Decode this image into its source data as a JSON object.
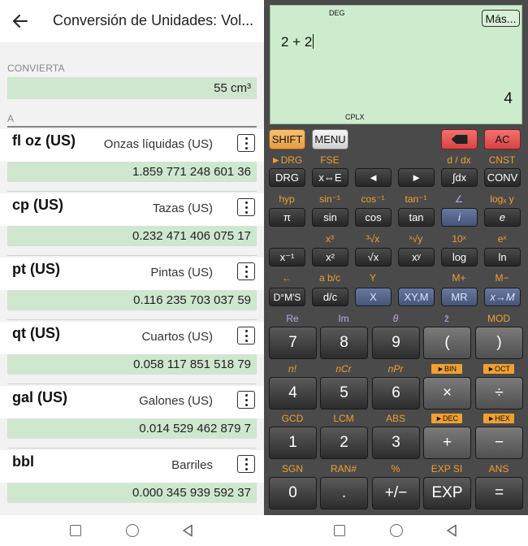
{
  "converter": {
    "title": "Conversión de Unidades: Vol...",
    "input_section": "CONVIERTA",
    "input_value": "55 cm³",
    "output_section": "A",
    "units": [
      {
        "symbol": "fl oz (US)",
        "name": "Onzas líquidas (US)",
        "value": "1.859 771 248 601 36"
      },
      {
        "symbol": "cp (US)",
        "name": "Tazas (US)",
        "value": "0.232 471 406 075 17"
      },
      {
        "symbol": "pt (US)",
        "name": "Pintas (US)",
        "value": "0.116 235 703 037 59"
      },
      {
        "symbol": "qt (US)",
        "name": "Cuartos (US)",
        "value": "0.058 117 851 518 79"
      },
      {
        "symbol": "gal (US)",
        "name": "Galones (US)",
        "value": "0.014 529 462 879 7"
      },
      {
        "symbol": "bbl",
        "name": "Barriles",
        "value": "0.000 345 939 592 37"
      }
    ]
  },
  "calculator": {
    "angle_mode": "DEG",
    "more_button": "Más...",
    "expression": "2 + 2",
    "result": "4",
    "complex_mode": "CPLX",
    "top_keys": {
      "shift": "SHIFT",
      "menu": "MENU",
      "clear": "AC"
    },
    "row1": {
      "labels": [
        "►DRG",
        "FSE",
        "",
        "",
        "d / dx",
        "CNST"
      ],
      "keys": [
        "DRG",
        "x⇔E",
        "◄",
        "►",
        "∫dx",
        "CONV"
      ]
    },
    "row2": {
      "labels": [
        "hyp",
        "sin⁻¹",
        "cos⁻¹",
        "tan⁻¹",
        "∠",
        "logₓ y"
      ],
      "keys": [
        "π",
        "sin",
        "cos",
        "tan",
        "i",
        "e"
      ]
    },
    "row3": {
      "labels": [
        "",
        "x³",
        "³√x",
        "ˣ√y",
        "10ˣ",
        "eˣ"
      ],
      "keys": [
        "x⁻¹",
        "x²",
        "√x",
        "xʸ",
        "log",
        "ln"
      ]
    },
    "row4": {
      "labels": [
        "←",
        "a b/c",
        "Y",
        "",
        "M+",
        "M−"
      ],
      "keys": [
        "D°M′S",
        "d/c",
        "X",
        "XY,M",
        "MR",
        "x→M"
      ]
    },
    "row5": {
      "labels": [
        "Re",
        "Im",
        "θ",
        "z̄",
        "MOD"
      ],
      "keys": [
        "7",
        "8",
        "9",
        "(",
        ")"
      ]
    },
    "row6": {
      "labels": [
        "n!",
        "nCr",
        "nPr"
      ],
      "tags": [
        "►BIN",
        "►OCT"
      ],
      "keys": [
        "4",
        "5",
        "6",
        "×",
        "÷"
      ]
    },
    "row7": {
      "labels": [
        "GCD",
        "LCM",
        "ABS"
      ],
      "tags": [
        "►DEC",
        "►HEX"
      ],
      "keys": [
        "1",
        "2",
        "3",
        "+",
        "−"
      ]
    },
    "row8": {
      "labels": [
        "SGN",
        "RAN#",
        "%",
        "EXP SI",
        "ANS"
      ],
      "keys": [
        "0",
        ".",
        "+/−",
        "EXP",
        "="
      ]
    }
  }
}
